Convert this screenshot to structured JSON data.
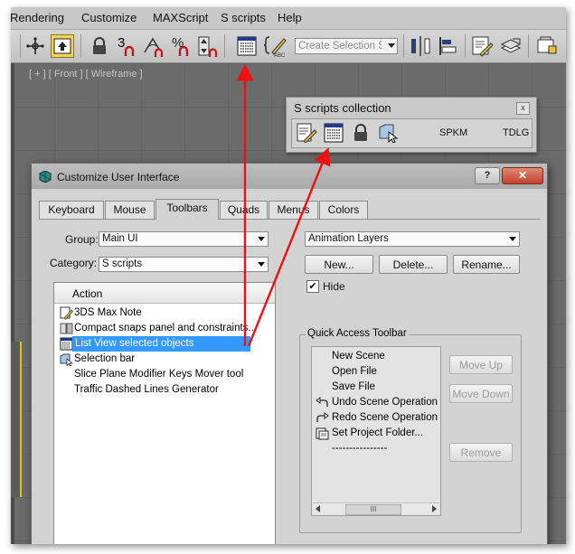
{
  "menubar": {
    "items": [
      "Rendering",
      "Customize",
      "MAXScript",
      "S scripts",
      "Help"
    ]
  },
  "toolbar": {
    "selection_set_placeholder": "Create Selection Se",
    "icons": [
      "select-move-icon",
      "select-object-icon",
      "lock-icon",
      "snap-3d-icon",
      "angle-snap-icon",
      "percent-snap-icon",
      "spinner-snap-icon",
      "list-view-script-icon",
      "edit-named-selection-icon",
      "mirror-icon",
      "align-icon",
      "edit-script-icon",
      "layer-icon",
      "render-icon"
    ],
    "snap_number": "3"
  },
  "viewport": {
    "label": "[ + ] [ Front ] [ Wireframe ]"
  },
  "floating_panel": {
    "title": "S scripts collection",
    "close_label": "x",
    "items": [
      {
        "icon": "edit-note-icon"
      },
      {
        "icon": "list-view-icon"
      },
      {
        "icon": "lock-icon"
      },
      {
        "icon": "selection-bar-icon"
      },
      {
        "label": "SPKM"
      },
      {
        "label": "TDLG"
      }
    ]
  },
  "dialog": {
    "title": "Customize User Interface",
    "help_label": "?",
    "close_label": "✕",
    "tabs": [
      "Keyboard",
      "Mouse",
      "Toolbars",
      "Quads",
      "Menus",
      "Colors"
    ],
    "active_tab": "Toolbars",
    "group_label": "Group:",
    "group_value": "Main UI",
    "category_label": "Category:",
    "category_value": "S scripts",
    "list_header": "Action",
    "actions": [
      {
        "label": "3DS Max Note",
        "icon": "edit-note-icon"
      },
      {
        "label": "Compact snaps panel and constraints...",
        "icon": "snap-panel-icon"
      },
      {
        "label": "List View selected objects",
        "icon": "list-view-icon",
        "selected": true
      },
      {
        "label": "Selection bar",
        "icon": "selection-bar-icon"
      },
      {
        "label": "Slice Plane Modifier Keys Mover tool",
        "icon": ""
      },
      {
        "label": "Traffic Dashed Lines Generator",
        "icon": ""
      }
    ],
    "toolbar_combo_value": "Animation Layers",
    "new_label": "New...",
    "delete_label": "Delete...",
    "rename_label": "Rename...",
    "hide_label": "Hide",
    "hide_checked": true,
    "quick_access_title": "Quick Access Toolbar",
    "quick_access_items": [
      {
        "label": "New Scene",
        "icon": ""
      },
      {
        "label": "Open File",
        "icon": ""
      },
      {
        "label": "Save File",
        "icon": ""
      },
      {
        "label": "Undo Scene Operation",
        "icon": "undo-icon"
      },
      {
        "label": "Redo Scene Operation",
        "icon": "redo-icon"
      },
      {
        "label": "Set Project Folder...",
        "icon": "project-folder-icon"
      },
      {
        "label": "----------------",
        "icon": ""
      }
    ],
    "move_up_label": "Move Up",
    "move_down_label": "Move Down",
    "remove_label": "Remove",
    "scroll_thumb": "III"
  },
  "colors": {
    "annotation_arrow": "#ee1111",
    "selection": "#3399ff",
    "close_button": "#c84a33"
  }
}
